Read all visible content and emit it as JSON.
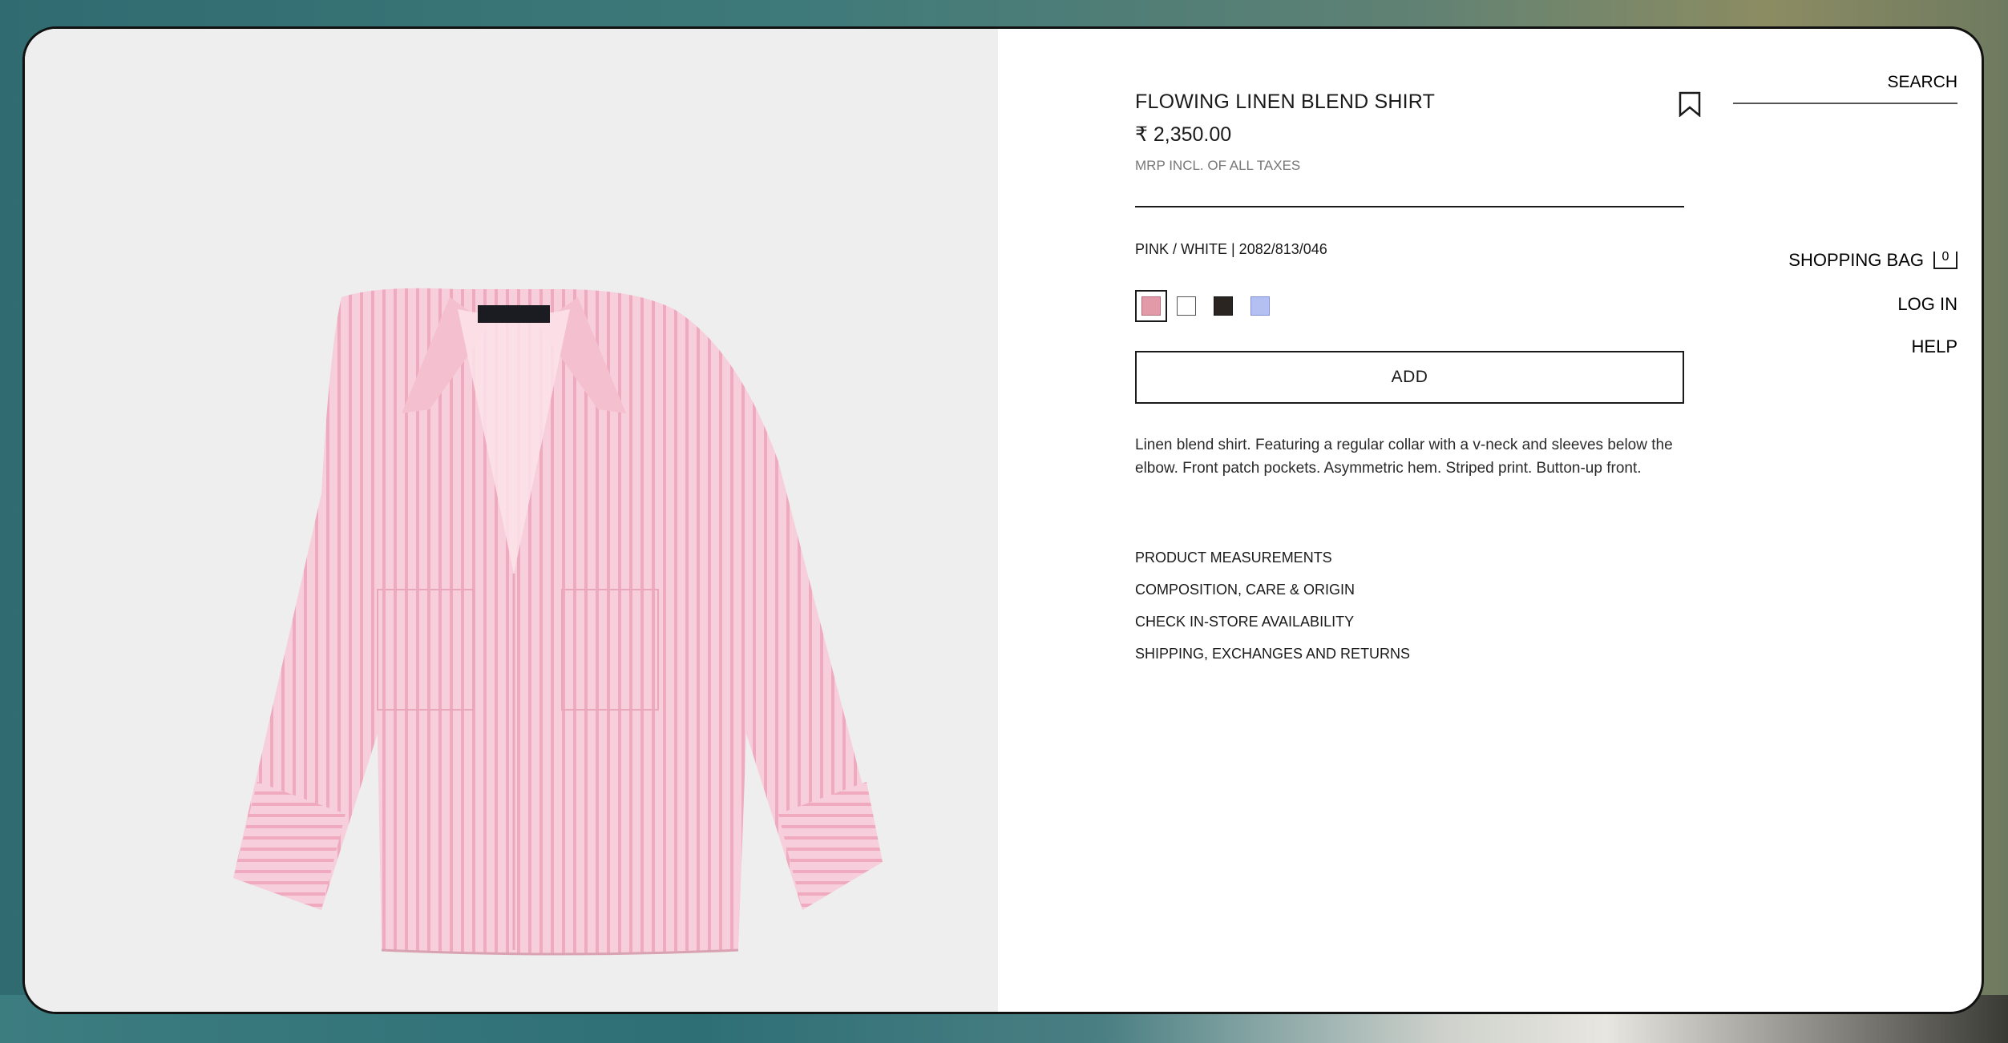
{
  "product": {
    "title": "FLOWING LINEN BLEND SHIRT",
    "price": "₹ 2,350.00",
    "tax_note": "MRP INCL. OF ALL TAXES",
    "color_ref": "PINK / WHITE | 2082/813/046",
    "swatches": [
      {
        "name": "pink",
        "color": "#e39aa8",
        "selected": true
      },
      {
        "name": "white",
        "color": "#ffffff",
        "selected": false
      },
      {
        "name": "black",
        "color": "#2a2520",
        "selected": false
      },
      {
        "name": "blue",
        "color": "#b4c0f2",
        "selected": false
      }
    ],
    "add_label": "ADD",
    "description": "Linen blend shirt. Featuring a regular collar with a v-neck and sleeves below the elbow. Front patch pockets. Asymmetric hem. Striped print. Button-up front.",
    "links": [
      "PRODUCT MEASUREMENTS",
      "COMPOSITION, CARE & ORIGIN",
      "CHECK IN-STORE AVAILABILITY",
      "SHIPPING, EXCHANGES AND RETURNS"
    ]
  },
  "nav": {
    "search": "SEARCH",
    "shopping_bag": "SHOPPING BAG",
    "bag_count": "0",
    "login": "LOG IN",
    "help": "HELP"
  }
}
